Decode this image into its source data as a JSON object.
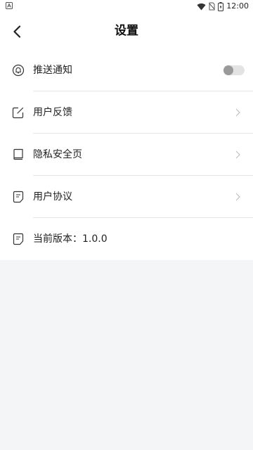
{
  "status_bar": {
    "time": "12:00"
  },
  "header": {
    "title": "设置",
    "back_icon": "back-arrow-icon"
  },
  "settings": {
    "items": [
      {
        "label": "推送通知",
        "icon": "bell-icon",
        "control": "toggle",
        "enabled": false
      },
      {
        "label": "用户反馈",
        "icon": "edit-icon",
        "control": "chevron"
      },
      {
        "label": "隐私安全页",
        "icon": "book-icon",
        "control": "chevron"
      },
      {
        "label": "用户协议",
        "icon": "document-icon",
        "control": "chevron"
      },
      {
        "label": "当前版本：1.0.0",
        "icon": "document-icon",
        "control": "none"
      }
    ]
  },
  "colors": {
    "background": "#f4f5f7",
    "surface": "#ffffff",
    "divider": "#e6e6e6",
    "toggle_track": "#e3e3e3",
    "toggle_knob": "#9a9a9a"
  }
}
